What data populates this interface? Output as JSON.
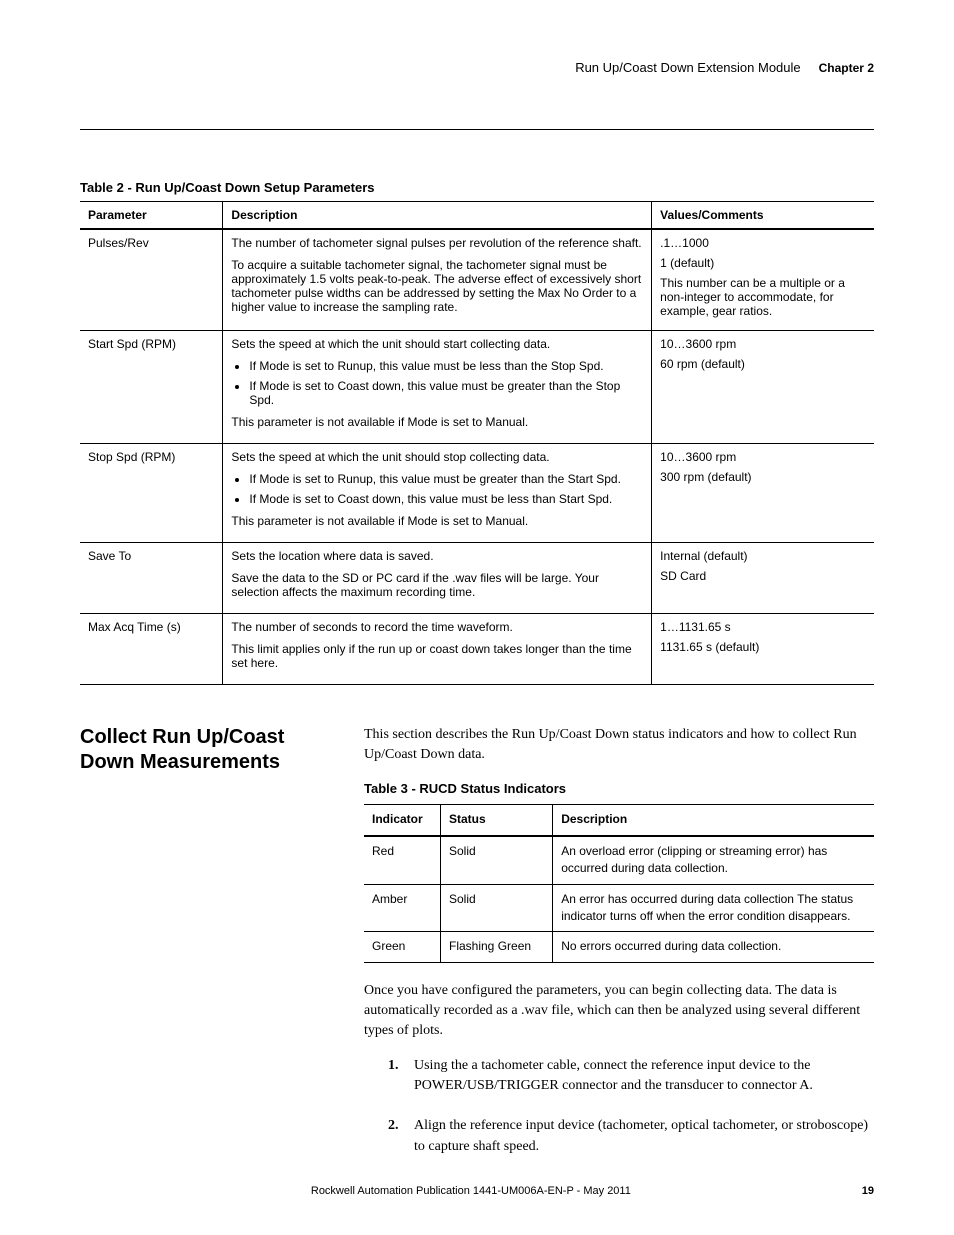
{
  "header": {
    "module_title": "Run Up/Coast Down Extension Module",
    "chapter": "Chapter 2"
  },
  "table2": {
    "caption": "Table 2 - Run Up/Coast Down Setup Parameters",
    "headers": {
      "param": "Parameter",
      "desc": "Description",
      "vals": "Values/Comments"
    },
    "rows": [
      {
        "param": "Pulses/Rev",
        "desc_p1": "The number of tachometer signal pulses per revolution of the reference shaft.",
        "desc_p2": "To acquire a suitable tachometer signal, the tachometer signal must be approximately 1.5 volts peak-to-peak. The adverse effect of excessively short tachometer pulse widths can be addressed by setting the Max No Order to a higher value to increase the sampling rate.",
        "vals_p1": ".1…1000",
        "vals_p2": "1 (default)",
        "vals_p3": "This number can be a multiple or a non-integer to accommodate, for example, gear ratios."
      },
      {
        "param": "Start Spd (RPM)",
        "desc_p1": "Sets the speed at which the unit should start collecting data.",
        "desc_li1": "If Mode is set to Runup, this value must be less than the Stop Spd.",
        "desc_li2": "If Mode is set to Coast down, this value must be greater than the Stop Spd.",
        "desc_p2": "This parameter is not available if Mode is set to Manual.",
        "vals_p1": "10…3600 rpm",
        "vals_p2": "60 rpm (default)"
      },
      {
        "param": "Stop Spd (RPM)",
        "desc_p1": "Sets the speed at which the unit should stop collecting data.",
        "desc_li1": "If Mode is set to Runup, this value must be greater than the Start Spd.",
        "desc_li2": "If Mode is set to Coast down, this value must be less than Start Spd.",
        "desc_p2": "This parameter is not available if Mode is set to Manual.",
        "vals_p1": "10…3600 rpm",
        "vals_p2": "300 rpm (default)"
      },
      {
        "param": "Save To",
        "desc_p1": "Sets the location where data is saved.",
        "desc_p2": "Save the data to the SD or PC card if the .wav files will be large. Your selection affects the maximum recording time.",
        "vals_p1": "Internal (default)",
        "vals_p2": "SD Card"
      },
      {
        "param": "Max Acq Time (s)",
        "desc_p1": "The number of seconds to record the time waveform.",
        "desc_p2": "This limit applies only if the run up or coast down takes longer than the time set here.",
        "vals_p1": "1…1131.65 s",
        "vals_p2": "1131.65 s (default)"
      }
    ]
  },
  "section": {
    "heading": "Collect Run Up/Coast Down Measurements",
    "intro": "This section describes the Run Up/Coast Down status indicators and how to collect Run Up/Coast Down data."
  },
  "table3": {
    "caption": "Table 3 - RUCD Status Indicators",
    "headers": {
      "ind": "Indicator",
      "stat": "Status",
      "desc": "Description"
    },
    "rows": [
      {
        "ind": "Red",
        "stat": "Solid",
        "desc": "An overload error (clipping or streaming error) has occurred during data collection."
      },
      {
        "ind": "Amber",
        "stat": "Solid",
        "desc": "An error has occurred during data collection The status indicator turns off when the error condition disappears."
      },
      {
        "ind": "Green",
        "stat": "Flashing Green",
        "desc": "No errors occurred during data collection."
      }
    ]
  },
  "body_para": "Once you have configured the parameters, you can begin collecting data. The data is automatically recorded as a .wav file, which can then be analyzed using several different types of plots.",
  "steps": [
    {
      "num": "1.",
      "text": "Using the a tachometer cable, connect the reference input device to the POWER/USB/TRIGGER connector and the transducer to connector A."
    },
    {
      "num": "2.",
      "text": "Align the reference input device (tachometer, optical tachometer, or stroboscope) to capture shaft speed."
    }
  ],
  "footer": {
    "pub": "Rockwell Automation Publication 1441-UM006A-EN-P - May 2011",
    "page": "19"
  }
}
